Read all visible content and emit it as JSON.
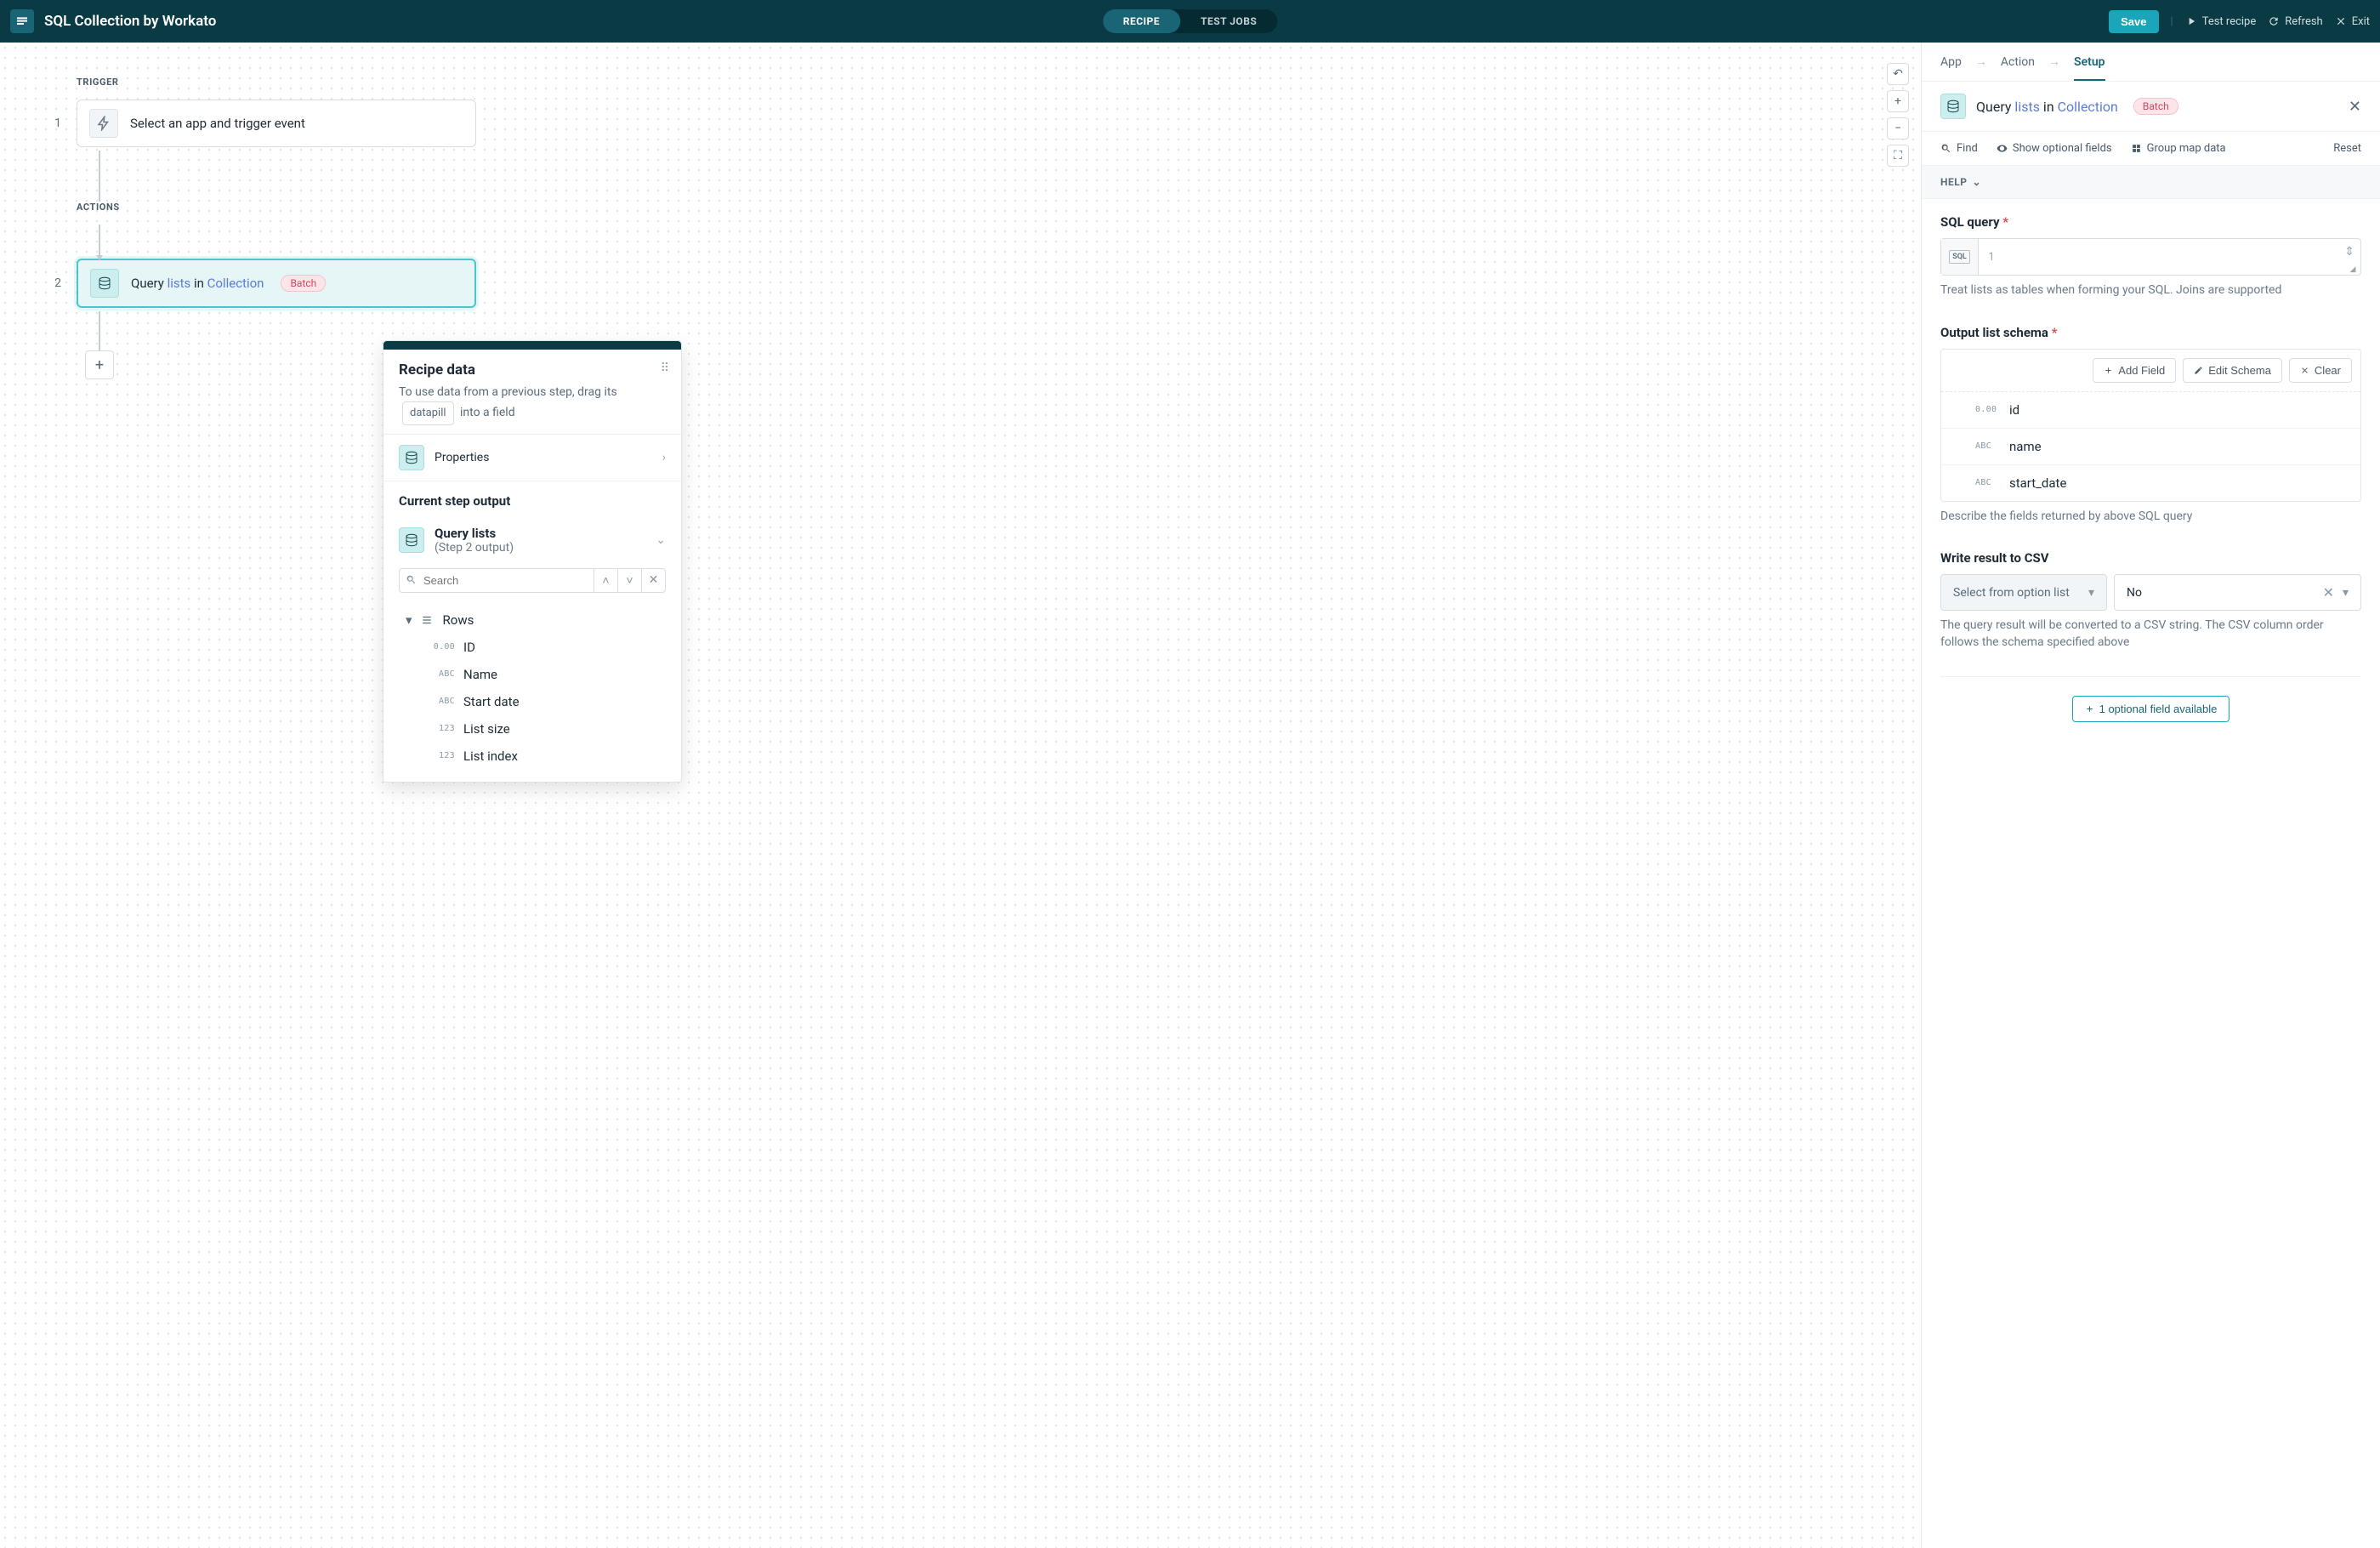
{
  "topbar": {
    "title": "SQL Collection by Workato",
    "tabs": {
      "recipe": "RECIPE",
      "test_jobs": "TEST JOBS"
    },
    "save": "Save",
    "test_recipe": "Test recipe",
    "refresh": "Refresh",
    "exit": "Exit"
  },
  "flow": {
    "trigger_label": "TRIGGER",
    "actions_label": "ACTIONS",
    "step1": {
      "num": "1",
      "text": "Select an app and trigger event"
    },
    "step2": {
      "num": "2",
      "prefix": "Query ",
      "lists": "lists",
      "in": " in ",
      "collection": "Collection",
      "batch": "Batch"
    }
  },
  "popover": {
    "title": "Recipe data",
    "desc1": "To use data from a previous step, drag its",
    "pill": "datapill",
    "desc2": "into a field",
    "properties": "Properties",
    "current_step": "Current step output",
    "query_lists_title": "Query lists",
    "query_lists_sub": "(Step 2 output)",
    "search_placeholder": "Search",
    "tree": {
      "rows": "Rows",
      "id": {
        "type": "0.00",
        "label": "ID"
      },
      "name": {
        "type": "ABC",
        "label": "Name"
      },
      "start_date": {
        "type": "ABC",
        "label": "Start date"
      },
      "list_size": {
        "type": "123",
        "label": "List size"
      },
      "list_index": {
        "type": "123",
        "label": "List index"
      }
    }
  },
  "panel": {
    "breadcrumb": {
      "app": "App",
      "action": "Action",
      "setup": "Setup"
    },
    "header": {
      "prefix": "Query ",
      "lists": "lists",
      "in": " in ",
      "collection": "Collection",
      "batch": "Batch"
    },
    "toolbar": {
      "find": "Find",
      "optional": "Show optional fields",
      "group": "Group map data",
      "reset": "Reset"
    },
    "help": "HELP",
    "sql_query": {
      "label": "SQL query",
      "line": "1",
      "badge": "SQL",
      "help": "Treat lists as tables when forming your SQL. Joins are supported"
    },
    "schema": {
      "label": "Output list schema",
      "add": "Add Field",
      "edit": "Edit Schema",
      "clear": "Clear",
      "rows": [
        {
          "type": "0.00",
          "name": "id"
        },
        {
          "type": "ABC",
          "name": "name"
        },
        {
          "type": "ABC",
          "name": "start_date"
        }
      ],
      "help": "Describe the fields returned by above SQL query"
    },
    "csv": {
      "label": "Write result to CSV",
      "select_prompt": "Select from option list",
      "value": "No",
      "help": "The query result will be converted to a CSV string. The CSV column order follows the schema specified above"
    },
    "optional_btn": "1 optional field available"
  }
}
